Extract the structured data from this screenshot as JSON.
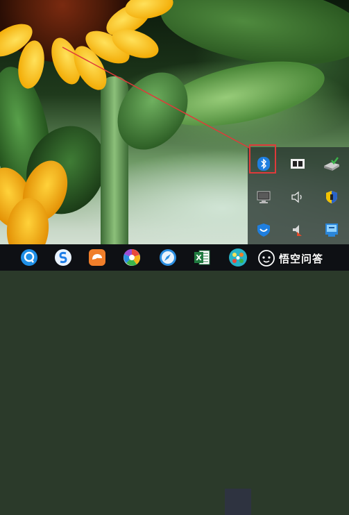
{
  "watermark": {
    "text": "悟空问答"
  },
  "taskbar": {
    "apps": [
      {
        "name": "search-q-icon",
        "color": "#1f8fe6"
      },
      {
        "name": "sogou-icon",
        "color": "#1e7ee8"
      },
      {
        "name": "uc-browser-icon",
        "color": "#f07e2a"
      },
      {
        "name": "photo-viewer-icon",
        "color": "#e9493c"
      },
      {
        "name": "safari-compass-icon",
        "color": "#2b8ee0"
      },
      {
        "name": "excel-icon",
        "color": "#1f7a3f",
        "letter": "X"
      },
      {
        "name": "video-player-icon",
        "color": "#27b3c7"
      }
    ]
  },
  "tray": {
    "icons": [
      "bluetooth-icon",
      "dual-monitor-icon",
      "usb-safely-remove-icon",
      "network-icon",
      "volume-icon",
      "security-shield-icon",
      "qq-pc-manager-icon",
      "speaker-volume-icon",
      "remote-desktop-icon"
    ]
  },
  "annotation": {
    "highlight_color": "#e03a3a"
  }
}
